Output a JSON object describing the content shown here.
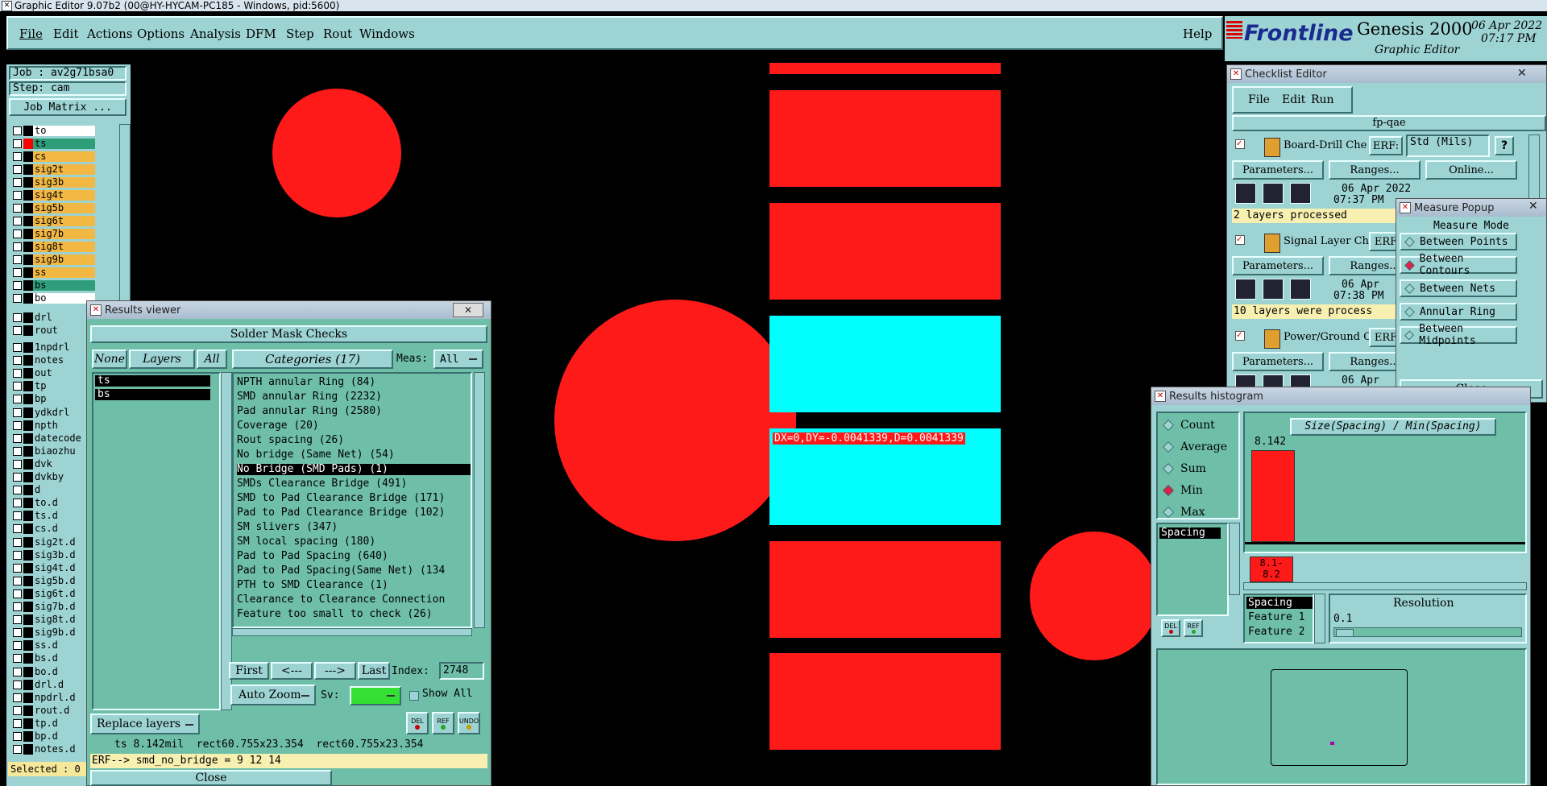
{
  "window_title": "Graphic Editor 9.07b2 (00@HY-HYCAM-PC185 - Windows, pid:5600)",
  "menu": [
    "File",
    "Edit",
    "Actions",
    "Options",
    "Analysis",
    "DFM",
    "Step",
    "Rout",
    "Windows"
  ],
  "help": "Help",
  "brand": {
    "logo": "Frontline",
    "product": "Genesis 2000",
    "subtitle": "Graphic Editor",
    "date": "06 Apr 2022",
    "time": "07:17 PM"
  },
  "job": {
    "job_label": "Job : av2g71bsa0",
    "step_label": "Step: cam",
    "matrix_button": "Job Matrix ..."
  },
  "layers_group1": [
    {
      "name": "to",
      "color": "#ffffff",
      "sw": "#000000"
    },
    {
      "name": "ts",
      "color": "#2e9e7a",
      "sw": "#ff0000"
    },
    {
      "name": "cs",
      "color": "#f3b844",
      "sw": "#000000"
    },
    {
      "name": "sig2t",
      "color": "#f3b844",
      "sw": "#000000"
    },
    {
      "name": "sig3b",
      "color": "#f3b844",
      "sw": "#000000"
    },
    {
      "name": "sig4t",
      "color": "#f3b844",
      "sw": "#000000"
    },
    {
      "name": "sig5b",
      "color": "#f3b844",
      "sw": "#000000"
    },
    {
      "name": "sig6t",
      "color": "#f3b844",
      "sw": "#000000"
    },
    {
      "name": "sig7b",
      "color": "#f3b844",
      "sw": "#000000"
    },
    {
      "name": "sig8t",
      "color": "#f3b844",
      "sw": "#000000"
    },
    {
      "name": "sig9b",
      "color": "#f3b844",
      "sw": "#000000"
    },
    {
      "name": "ss",
      "color": "#f3b844",
      "sw": "#000000"
    },
    {
      "name": "bs",
      "color": "#2e9e7a",
      "sw": "#000000"
    },
    {
      "name": "bo",
      "color": "#ffffff",
      "sw": "#000000"
    }
  ],
  "layers_group2": [
    {
      "name": "drl",
      "color": "#9dd3d3"
    },
    {
      "name": "rout",
      "color": "#9dd3d3"
    }
  ],
  "layers_group3": [
    {
      "name": "1npdrl"
    },
    {
      "name": "notes"
    },
    {
      "name": "out"
    },
    {
      "name": "tp"
    },
    {
      "name": "bp"
    },
    {
      "name": "ydkdrl"
    },
    {
      "name": "npth"
    },
    {
      "name": "datecode"
    },
    {
      "name": "biaozhu"
    },
    {
      "name": "dvk"
    },
    {
      "name": "dvkby"
    },
    {
      "name": "d"
    },
    {
      "name": "to.d"
    },
    {
      "name": "ts.d"
    },
    {
      "name": "cs.d"
    },
    {
      "name": "sig2t.d"
    },
    {
      "name": "sig3b.d"
    },
    {
      "name": "sig4t.d"
    },
    {
      "name": "sig5b.d"
    },
    {
      "name": "sig6t.d"
    },
    {
      "name": "sig7b.d"
    },
    {
      "name": "sig8t.d"
    },
    {
      "name": "sig9b.d"
    },
    {
      "name": "ss.d"
    },
    {
      "name": "bs.d"
    },
    {
      "name": "bo.d"
    },
    {
      "name": "drl.d"
    },
    {
      "name": "npdrl.d"
    },
    {
      "name": "rout.d"
    },
    {
      "name": "tp.d"
    },
    {
      "name": "bp.d"
    },
    {
      "name": "notes.d"
    }
  ],
  "selected": "Selected : 0",
  "measure_text": "DX=0,DY=-0.0041339,D=0.0041339",
  "results_viewer": {
    "title": "Results viewer",
    "header": "Solder Mask Checks",
    "none": "None",
    "layers": "Layers",
    "all": "All",
    "categories": "Categories (17)",
    "meas_label": "Meas:",
    "meas_value": "All",
    "layer_list": [
      "ts",
      "bs"
    ],
    "categories_list": [
      "NPTH annular Ring (84)",
      "SMD annular Ring (2232)",
      "Pad annular Ring (2580)",
      "Coverage (20)",
      "Rout spacing (26)",
      "No bridge (Same Net) (54)",
      "No Bridge (SMD Pads) (1)",
      "SMDs Clearance Bridge (491)",
      "SMD to Pad Clearance Bridge (171)",
      "Pad to Pad Clearance Bridge (102)",
      "SM slivers (347)",
      "SM local spacing (180)",
      "Pad to Pad Spacing (640)",
      "Pad to Pad Spacing(Same Net) (134",
      "PTH to SMD Clearance (1)",
      "Clearance to Clearance Connection",
      "Feature too small to check (26)"
    ],
    "selected_index": 6,
    "first": "First",
    "prev": "<---",
    "next": "--->",
    "last": "Last",
    "index_label": "Index:",
    "index_value": "2748",
    "auto_zoom": "Auto Zoom",
    "sv": "Sv:",
    "show_all": "Show All",
    "replace_layers": "Replace layers",
    "del": "DEL",
    "ref": "REF",
    "undo": "UNDO",
    "status": "ts 8.142mil  rect60.755x23.354  rect60.755x23.354",
    "erf": "ERF--> smd_no_bridge = 9 12 14",
    "close": "Close"
  },
  "checklist": {
    "title": "Checklist Editor",
    "menu": [
      "File",
      "Edit",
      "Run"
    ],
    "name": "fp-qae",
    "erf_label": "ERF:",
    "erf_value": "Std (Mils)",
    "help": "?",
    "items": [
      {
        "name": "Board-Drill Che",
        "date": "06 Apr 2022",
        "time": "07:37 PM",
        "status": "2 layers processed"
      },
      {
        "name": "Signal Layer Ch",
        "date": "06 Apr",
        "time": "07:38 PM",
        "status": "10 layers were process"
      },
      {
        "name": "Power/Ground C",
        "date": "06 Apr",
        "time": "",
        "status": ""
      }
    ],
    "params": "Parameters...",
    "ranges": "Ranges...",
    "online": "Online...",
    "erf_short": "ERF"
  },
  "measure_popup": {
    "title": "Measure Popup",
    "mode_label": "Measure Mode",
    "modes": [
      "Between Points",
      "Between Contours",
      "Between Nets",
      "Annular Ring",
      "Between Midpoints"
    ],
    "selected": 1,
    "close": "Close"
  },
  "histogram": {
    "title": "Results histogram",
    "modes": [
      "Count",
      "Average",
      "Sum",
      "Min",
      "Max"
    ],
    "selected": 3,
    "left_list": [
      "Spacing"
    ],
    "chart_title": "Size(Spacing) / Min(Spacing)",
    "bar_value": "8.142",
    "bar_label": "8.1-\n8.2",
    "fields": [
      "Spacing",
      "Feature 1",
      "Feature 2"
    ],
    "resolution_label": "Resolution",
    "resolution_value": "0.1",
    "del": "DEL",
    "ref": "REF"
  },
  "colors": {
    "pad": "#ff1a1a",
    "highlight": "#00ffff",
    "teal": "#9dd3d3",
    "dark_teal": "#6fbfa8"
  }
}
